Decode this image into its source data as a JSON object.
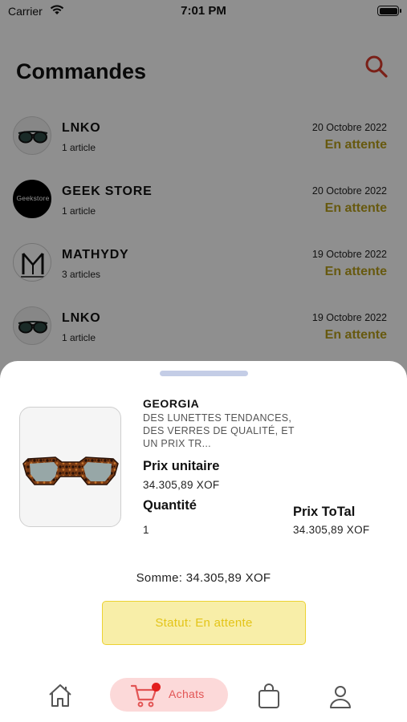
{
  "status_bar": {
    "carrier": "Carrier",
    "time": "7:01 PM"
  },
  "header": {
    "title": "Commandes",
    "search_icon": "search-icon",
    "accent_color": "#d9392b"
  },
  "orders": [
    {
      "store": "LNKO",
      "count": "1 article",
      "date": "20 Octobre 2022",
      "status": "En attente",
      "avatar": "sunglasses-logo"
    },
    {
      "store": "GEEK STORE",
      "count": "1 article",
      "date": "20 Octobre 2022",
      "status": "En attente",
      "avatar": "geekstore-logo",
      "avatar_text": "Geekstore"
    },
    {
      "store": "MATHYDY",
      "count": "3 articles",
      "date": "19 Octobre 2022",
      "status": "En attente",
      "avatar": "mathydy-logo"
    },
    {
      "store": "LNKO",
      "count": "1 article",
      "date": "19 Octobre 2022",
      "status": "En attente",
      "avatar": "sunglasses-logo"
    }
  ],
  "sheet": {
    "product": {
      "name": "GEORGIA",
      "description": "DES LUNETTES TENDANCES, DES VERRES DE QUALITÉ, ET UN PRIX TR...",
      "image_icon": "tortoise-sunglasses-image"
    },
    "unit_price_label": "Prix unitaire",
    "unit_price_value": "34.305,89  XOF",
    "quantity_label": "Quantité",
    "quantity_value": "1",
    "total_label": "Prix ToTal",
    "total_value": "34.305,89  XOF",
    "sum_text": "Somme: 34.305,89  XOF",
    "status_text": "Statut: En attente",
    "status_bg": "#f8eea8",
    "status_color": "#e3c418"
  },
  "tabbar": {
    "home_icon": "home-icon",
    "achats_label": "Achats",
    "achats_icon": "cart-icon",
    "bag_icon": "shopping-bag-icon",
    "profile_icon": "user-icon",
    "active_color": "#e25555"
  }
}
